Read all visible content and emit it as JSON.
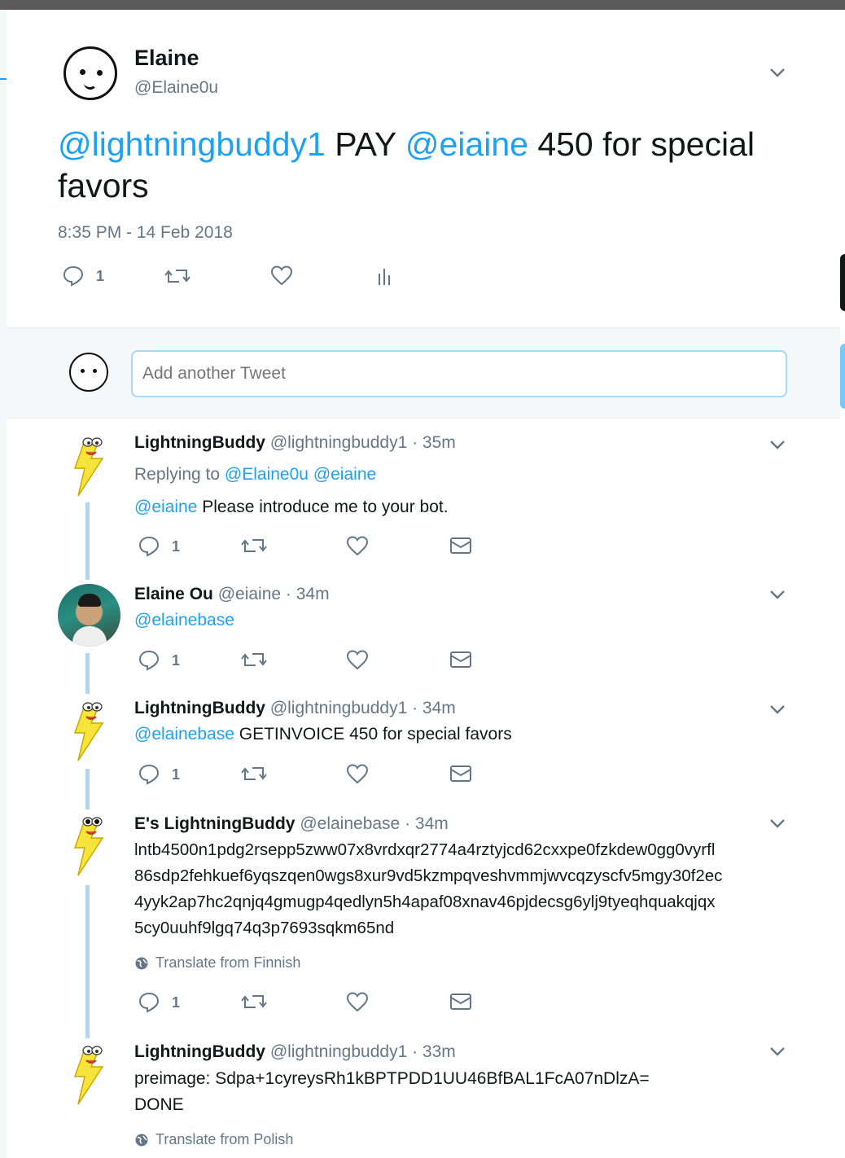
{
  "main_tweet": {
    "author_name": "Elaine",
    "author_handle": "@Elaine0u",
    "text_mention1": "@lightningbuddy1",
    "text_mid1": " PAY ",
    "text_mention2": "@eiaine",
    "text_rest": " 450 for special favors",
    "timestamp": "8:35 PM - 14 Feb 2018",
    "reply_count": "1"
  },
  "composer": {
    "placeholder": "Add another Tweet"
  },
  "replies": [
    {
      "name": "LightningBuddy",
      "handle": "@lightningbuddy1",
      "time": "· 35m",
      "replying_prefix": "Replying to ",
      "replying_to1": "@Elaine0u",
      "replying_to2": "@eiaine",
      "mention": "@eiaine",
      "text": " Please introduce me to your bot.",
      "reply_count": "1"
    },
    {
      "name": "Elaine Ou",
      "handle": "@eiaine",
      "time": "· 34m",
      "mention": "@elainebase",
      "reply_count": "1"
    },
    {
      "name": "LightningBuddy",
      "handle": "@lightningbuddy1",
      "time": "· 34m",
      "mention": "@elainebase",
      "text": " GETINVOICE 450  for special favors",
      "reply_count": "1"
    },
    {
      "name": "E's LightningBuddy",
      "handle": "@elainebase",
      "time": "· 34m",
      "lines": [
        "lntb4500n1pdg2rsepp5zww07x8vrdxqr2774a4rztyjcd62cxxpe0fzkdew0gg0vyrfl",
        "86sdp2fehkuef6yqszqen0wgs8xur9vd5kzmpqveshvmmjwvcqzyscfv5mgy30f2ec",
        "4yyk2ap7hc2qnjq4gmugp4qedlyn5h4apaf08xnav46pjdecsg6ylj9tyeqhquakqjqx",
        "5cy0uuhf9lgq74q3p7693sqkm65nd"
      ],
      "translate": "Translate from Finnish",
      "reply_count": "1"
    },
    {
      "name": "LightningBuddy",
      "handle": "@lightningbuddy1",
      "time": "· 33m",
      "lines": [
        "preimage: Sdpa+1cyreysRh1kBPTPDD1UU46BfBAL1FcA07nDlzA=",
        "DONE"
      ],
      "translate": "Translate from Polish"
    }
  ],
  "colors": {
    "link": "#1da1f2",
    "muted": "#657786",
    "thread_line": "#aad8f8",
    "bolt": "#f7e43a"
  },
  "icons": [
    "chevron-down-icon",
    "reply-icon",
    "retweet-icon",
    "like-icon",
    "analytics-icon",
    "dm-icon",
    "globe-icon",
    "lightning-bolt-avatar-icon"
  ]
}
